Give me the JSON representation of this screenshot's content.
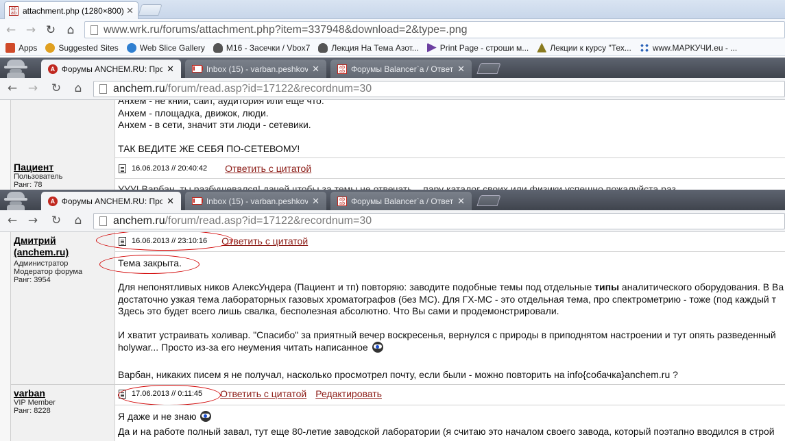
{
  "outer": {
    "tab_title": "attachment.php (1280×800)",
    "tab_favicon": "forum-favicon",
    "url": "www.wrk.ru/forums/attachment.php?item=337948&download=2&type=.png",
    "bookmarks": [
      {
        "label": "Apps",
        "icon": "apps-icon",
        "color": "#d04a2a"
      },
      {
        "label": "Suggested Sites",
        "icon": "ie-icon",
        "color": "#e0a020"
      },
      {
        "label": "Web Slice Gallery",
        "icon": "ie-icon",
        "color": "#2f7fd0"
      },
      {
        "label": "M16 - Засечки / Vbox7",
        "icon": "skull-icon",
        "color": "#555555"
      },
      {
        "label": "Лекция На Тема Азот...",
        "icon": "skull-icon",
        "color": "#555555"
      },
      {
        "label": "Print Page - строши м...",
        "icon": "arrow-icon",
        "color": "#6b3fa0"
      },
      {
        "label": "Лекции к курсу \"Тех...",
        "icon": "tower-icon",
        "color": "#8a7b20"
      },
      {
        "label": "www.МАРКУЧИ.eu - ...",
        "icon": "dots-icon",
        "color": "#2a62b8"
      }
    ]
  },
  "inner_tabs": [
    {
      "title": "Форумы ANCHEM.RU: Проц",
      "icon": "anchem-icon",
      "active": true
    },
    {
      "title": "Inbox (15) - varban.peshkov",
      "icon": "gmail-icon",
      "active": false
    },
    {
      "title": "Форумы Balancer`a / Ответ",
      "icon": "balancer-icon",
      "active": false
    }
  ],
  "inner_url": {
    "host": "anchem.ru",
    "path": "/forum/read.asp?id=17122&recordnum=30"
  },
  "top_forum": {
    "lines": [
      "Анхем - не книи, сайт, аудитория или еще что.",
      "Анхем - площадка, движок, люди.",
      "Анхем - в сети, значит эти люди - сетевики.",
      "",
      "ТАК ВЕДИТЕ ЖЕ СЕБЯ ПО-СЕТЕВОМУ!"
    ],
    "post": {
      "user": "Пациент",
      "role": "Пользователь",
      "rank": "Ранг: 78",
      "date": "16.06.2013 // 20:40:42",
      "quote_link": "Ответить с цитатой",
      "partial_line": "УУУ! Варбан, ты разбушевался! дачей чтобы за темы не отвечать... пару каталог своих или физики успешно пожалуйста раз"
    }
  },
  "bottom_forum": {
    "post1": {
      "user": "Дмитрий (anchem.ru)",
      "user_line1": "Дмитрий",
      "user_line2": "(anchem.ru)",
      "role": "Администратор",
      "role2": "Модератор форума",
      "rank": "Ранг: 3954",
      "date": "16.06.2013 // 23:10:16",
      "quote_link": "Ответить с цитатой",
      "line1": "Тема закрыта.",
      "p1a_pre": "Для непонятливых ников АлексУндера (Пациент и тп) повторяю: заводите подобные темы под отдельные ",
      "p1a_bold": "типы",
      "p1a_post": " аналитического оборудования. В Ва",
      "p1b": "достаточно узкая тема лабораторных газовых хроматографов (без МС). Для ГХ-МС - это отдельная тема, про спектрометрию - тоже (под каждый т",
      "p1c": "Здесь это будет всего лишь свалка, бесполезная абсолютно. Что Вы сами и продемонстрировали.",
      "p2a": "И хватит устраивать холивар. \"Спасибо\" за приятный вечер воскресенья, вернулся с природы в приподнятом настроении и тут опять разведенный",
      "p2b": "holywar... Просто из-за его неумения читать написанное",
      "p3": "Варбан, никаких писем я не получал, насколько просмотрел почту, если были - можно повторить на info{собачка}anchem.ru ?"
    },
    "post2": {
      "user": "varban",
      "role": "VIP Member",
      "rank": "Ранг: 8228",
      "date": "17.06.2013 // 0:11:45",
      "quote_link": "Ответить с цитатой",
      "edit_link": "Редактировать",
      "line1": "Я даже и не знаю",
      "line2": "Да и на работе полный завал, тут еще 80-летие заводской лаборатории (я считаю это началом своего завода, который поэтапно вводился в строй"
    }
  },
  "colors": {
    "link": "#8b1a14",
    "annotation": "#d10000",
    "chrome_dark": "#4a4f58"
  }
}
